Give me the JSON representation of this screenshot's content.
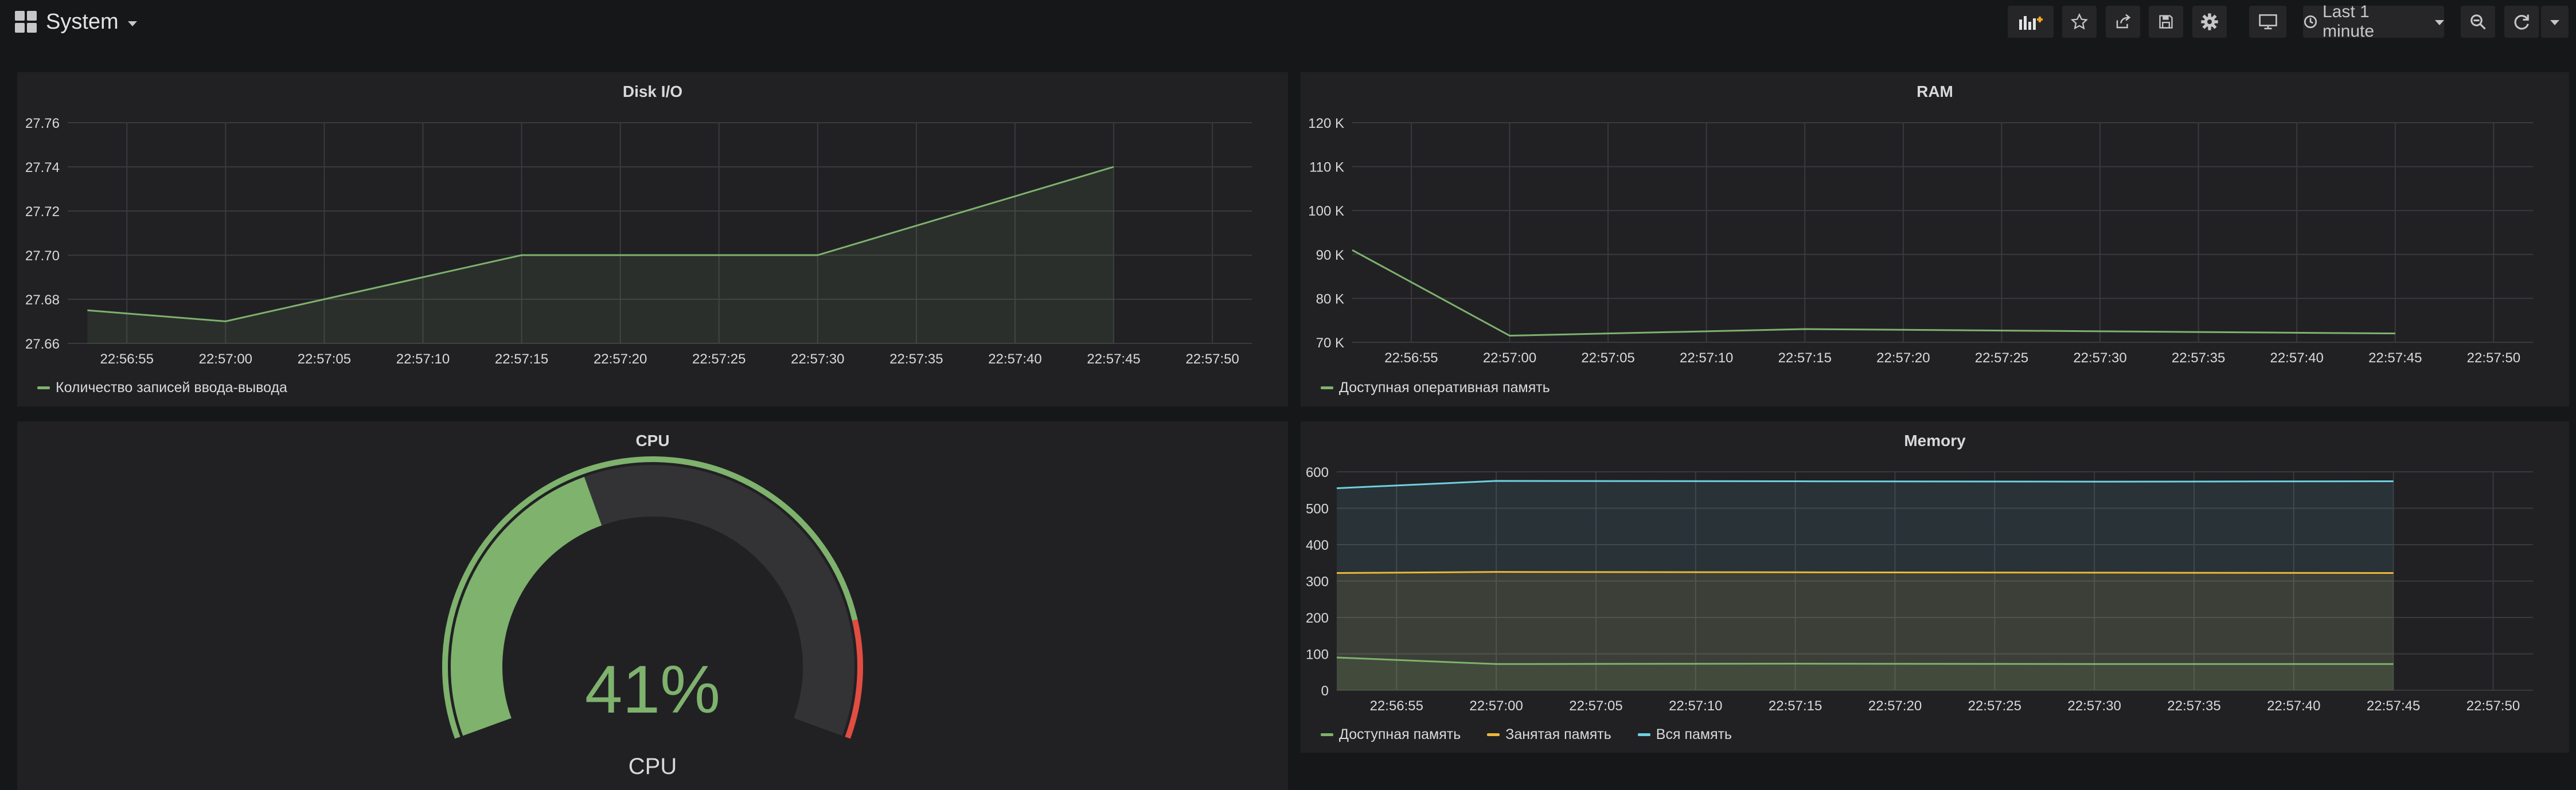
{
  "dashboard": {
    "title": "System"
  },
  "toolbar": {
    "add_panel_icon": "add-panel-icon",
    "star_icon": "star-icon",
    "share_icon": "share-icon",
    "save_icon": "save-icon",
    "settings_icon": "gear-icon",
    "tv_icon": "tv-icon",
    "time_range": "Last 1 minute",
    "zoom_icon": "zoom-out-icon",
    "refresh_icon": "refresh-icon"
  },
  "colors": {
    "green": "#7eb26d",
    "yellow": "#eab839",
    "blue": "#6ed0e0",
    "red": "#e24d42"
  },
  "panels": {
    "disk": {
      "title": "Disk I/O",
      "legend": [
        "Количество записей ввода-вывода"
      ],
      "chart_data": {
        "type": "area",
        "x": [
          "22:56:53",
          "22:57:00",
          "22:57:15",
          "22:57:30",
          "22:57:45"
        ],
        "series": [
          {
            "name": "Количество записей ввода-вывода",
            "values": [
              27.675,
              27.67,
              27.7,
              27.7,
              27.74
            ],
            "color": "#7eb26d"
          }
        ],
        "x_ticks": [
          "22:56:55",
          "22:57:00",
          "22:57:05",
          "22:57:10",
          "22:57:15",
          "22:57:20",
          "22:57:25",
          "22:57:30",
          "22:57:35",
          "22:57:40",
          "22:57:45",
          "22:57:50"
        ],
        "y_ticks": [
          "27.66",
          "27.68",
          "27.70",
          "27.72",
          "27.74",
          "27.76"
        ],
        "ylim": [
          27.66,
          27.76
        ],
        "xlim": [
          "22:56:52",
          "22:57:52"
        ],
        "grid": true,
        "legend_position": "bottom-left"
      }
    },
    "ram": {
      "title": "RAM",
      "legend": [
        "Доступная оперативная память"
      ],
      "chart_data": {
        "type": "line",
        "x": [
          "22:56:52",
          "22:57:00",
          "22:57:15",
          "22:57:30",
          "22:57:45"
        ],
        "series": [
          {
            "name": "Доступная оперативная память",
            "values": [
              91000,
              71500,
              73000,
              72500,
              72000
            ],
            "color": "#7eb26d"
          }
        ],
        "x_ticks": [
          "22:56:55",
          "22:57:00",
          "22:57:05",
          "22:57:10",
          "22:57:15",
          "22:57:20",
          "22:57:25",
          "22:57:30",
          "22:57:35",
          "22:57:40",
          "22:57:45",
          "22:57:50"
        ],
        "y_ticks": [
          "70 K",
          "80 K",
          "90 K",
          "100 K",
          "110 K",
          "120 K"
        ],
        "ylim": [
          70000,
          120000
        ],
        "xlim": [
          "22:56:52",
          "22:57:52"
        ],
        "grid": true,
        "legend_position": "bottom-left"
      }
    },
    "cpu": {
      "title": "CPU",
      "value_text": "41%",
      "gauge_label": "CPU",
      "chart_data": {
        "type": "gauge",
        "value": 41,
        "min": 0,
        "max": 100,
        "thresholds": [
          {
            "to": 85,
            "color": "#7eb26d"
          },
          {
            "to": 100,
            "color": "#e24d42"
          }
        ]
      }
    },
    "memory": {
      "title": "Memory",
      "legend": [
        "Доступная память",
        "Занятая память",
        "Вся память"
      ],
      "chart_data": {
        "type": "area",
        "x": [
          "22:56:52",
          "22:57:00",
          "22:57:15",
          "22:57:30",
          "22:57:45"
        ],
        "series": [
          {
            "name": "Доступная память",
            "values": [
              90,
              72,
              73,
              72,
              72
            ],
            "color": "#7eb26d"
          },
          {
            "name": "Занятая память",
            "values": [
              322,
              325,
              324,
              323,
              322
            ],
            "color": "#eab839"
          },
          {
            "name": "Вся память",
            "values": [
              555,
              575,
              574,
              573,
              574
            ],
            "color": "#6ed0e0"
          }
        ],
        "x_ticks": [
          "22:56:55",
          "22:57:00",
          "22:57:05",
          "22:57:10",
          "22:57:15",
          "22:57:20",
          "22:57:25",
          "22:57:30",
          "22:57:35",
          "22:57:40",
          "22:57:45",
          "22:57:50"
        ],
        "y_ticks": [
          "0",
          "100",
          "200",
          "300",
          "400",
          "500",
          "600"
        ],
        "ylim": [
          0,
          600
        ],
        "xlim": [
          "22:56:52",
          "22:57:52"
        ],
        "grid": true,
        "legend_position": "bottom-left"
      }
    }
  }
}
